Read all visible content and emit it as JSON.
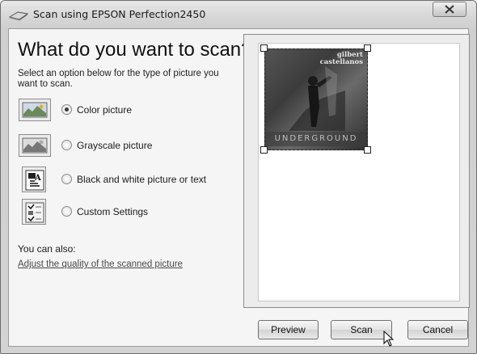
{
  "window": {
    "title": "Scan using EPSON Perfection2450",
    "close_glyph": "✕"
  },
  "main": {
    "heading": "What do you want to scan?",
    "subtitle": "Select an option below for the type of picture you want to scan.",
    "options": [
      {
        "label": "Color picture",
        "checked": true,
        "icon": "color-picture-icon"
      },
      {
        "label": "Grayscale picture",
        "checked": false,
        "icon": "grayscale-picture-icon"
      },
      {
        "label": "Black and white picture or text",
        "checked": false,
        "icon": "black-white-picture-icon"
      },
      {
        "label": "Custom Settings",
        "checked": false,
        "icon": "custom-settings-icon"
      }
    ],
    "also_label": "You can also:",
    "adjust_link": "Adjust the quality of the scanned picture"
  },
  "preview": {
    "photo_text_top": "gilbert castellanos",
    "photo_text_bottom": "UNDERGROUND"
  },
  "buttons": {
    "preview": "Preview",
    "scan": "Scan",
    "cancel": "Cancel"
  }
}
